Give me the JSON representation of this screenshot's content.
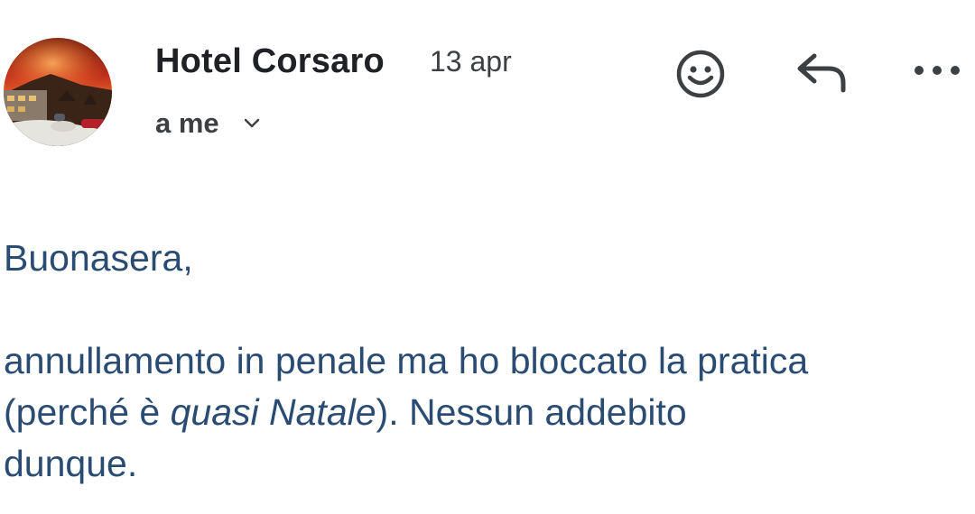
{
  "header": {
    "avatar_icon": "hotel-photo-avatar",
    "sender_name": "Hotel Corsaro",
    "date": "13 apr",
    "recipient": "a me",
    "expand_icon": "chevron-down-icon",
    "actions": [
      {
        "icon": "smiley-icon",
        "name": "emoji-reaction"
      },
      {
        "icon": "reply-icon",
        "name": "reply"
      },
      {
        "icon": "more-vert-icon",
        "name": "more-options"
      }
    ]
  },
  "message": {
    "greeting": "Buonasera,",
    "line1": "annullamento in penale ma ho bloccato la pratica",
    "line2_pre": "(perché è ",
    "line2_em": "quasi Natale",
    "line2_post": "). Nessun addebito",
    "line3": "dunque."
  },
  "colors": {
    "body_text": "#2a4c73",
    "sender_text": "#202124",
    "meta_text": "#3c4043",
    "icon": "#3c4043"
  }
}
